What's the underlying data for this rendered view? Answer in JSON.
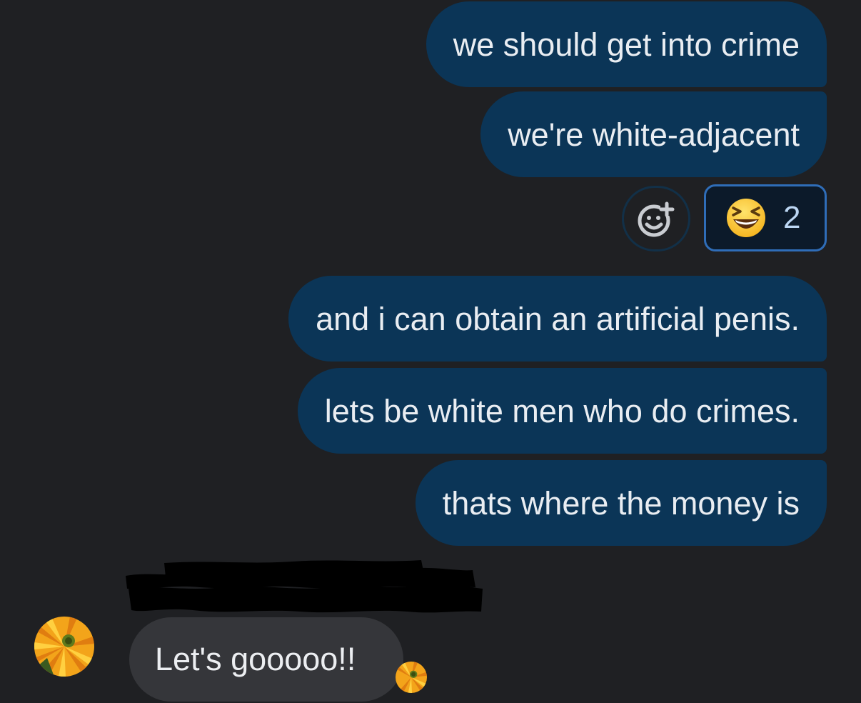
{
  "conversation": {
    "outgoing": [
      {
        "text": "we should get into crime"
      },
      {
        "text": "we're white-adjacent"
      },
      {
        "text": "and i can obtain an artificial penis."
      },
      {
        "text": "lets be white men who do crimes."
      },
      {
        "text": "thats where the money is"
      }
    ],
    "reaction": {
      "emoji": "grinning-squinting-face",
      "count": "2",
      "add_icon": "add-reaction-icon"
    },
    "incoming": {
      "sender_name": "",
      "text": "Let's gooooo!!",
      "avatar": "sunflower-avatar"
    },
    "read_receipt": {
      "avatar": "sunflower-avatar"
    }
  },
  "colors": {
    "background": "#1f2023",
    "outgoing_bubble": "#0b3557",
    "incoming_bubble": "#35363a",
    "reaction_border": "#2f6db8",
    "text": "#e9edf2"
  }
}
